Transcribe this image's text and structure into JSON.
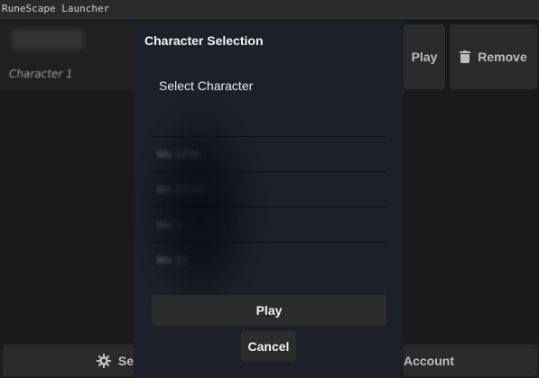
{
  "window": {
    "title": "RuneScape Launcher"
  },
  "background": {
    "account_name": "",
    "character_label": "Character 1",
    "play_label": "Play",
    "remove_label": "Remove",
    "settings_label": "Se",
    "account_label": "Account"
  },
  "dialog": {
    "title": "Character Selection",
    "label": "Select Character",
    "characters": [
      {
        "name": "Mo 1234"
      },
      {
        "name": "Mo 1234b"
      },
      {
        "name": "Mo 1"
      },
      {
        "name": "Mo 11"
      }
    ],
    "play_label": "Play",
    "cancel_label": "Cancel"
  }
}
